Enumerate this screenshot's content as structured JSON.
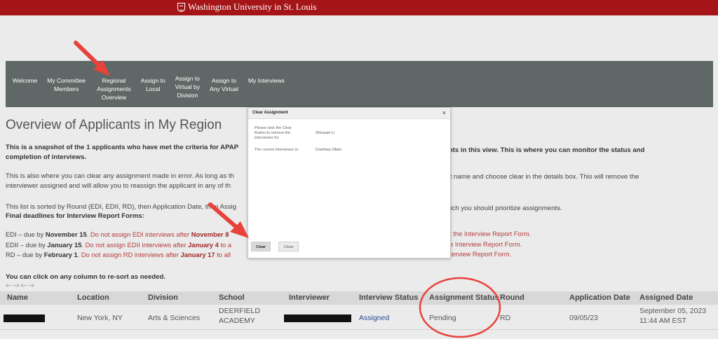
{
  "brand": {
    "name": "Washington University in St. Louis"
  },
  "nav": {
    "items": [
      "Welcome",
      "My Committee\nMembers",
      "Regional\nAssignments\nOverview",
      "Assign to\nLocal",
      "Assign to\nVirtual by\nDivision",
      "Assign to\nAny Virtual",
      "My Interviews"
    ]
  },
  "page": {
    "title": "Overview of Applicants in My Region",
    "p1_left": "This is a snapshot of the 1 applicants who have met the criteria for APAP",
    "p1_right": "ments in this view. This is where you can monitor the status and",
    "p1_line2": "completion of interviews.",
    "p2_left": "This is also where you can clear any assignment made in error.  As long as th",
    "p2_right": "licant name and choose clear in the details box.  This will remove the",
    "p2_line2": "interviewer assigned and will allow you to reassign the applicant in any of th",
    "p3_left": "This list is sorted by Round (EDI, EDII, RD), then Application Date, then Assig",
    "p3_right": "which you should prioritize assignments.",
    "p4": "Final deadlines for Interview Report Forms:",
    "deadlines": [
      {
        "lead": "EDI – due by ",
        "date": "November 15",
        "warn": ".  Do not assign EDI interviews after ",
        "wdate": "November 8",
        "rest": "bmit the Interview Report Form."
      },
      {
        "lead": "EDII – due by ",
        "date": "January 15",
        "warn": ".  Do not assign EDII interviews after ",
        "wdate": "January 4",
        "wtail": " to a",
        "rest": "it the Interview Report Form."
      },
      {
        "lead": "RD – due by ",
        "date": "February 1",
        "warn": ".  Do not assign RD interviews after ",
        "wdate": "January 17",
        "wtail": " to all",
        "rest": "e Interview Report Form."
      }
    ],
    "resort": "You can click on any column to re-sort as needed.",
    "pager": "<-- --> <-- -->"
  },
  "table": {
    "headers": [
      "Name",
      "Location",
      "Division",
      "School",
      "Interviewer",
      "Interview Status",
      "Assignment Status",
      "Round",
      "Application Date",
      "Assigned Date"
    ],
    "row": {
      "location": "New York, NY",
      "division": "Arts & Sciences",
      "school_line1": "DEERFIELD",
      "school_line2": "ACADEMY",
      "interview_status": "Assigned",
      "assignment_status": "Pending",
      "round": "RD",
      "application_date": "09/05/23",
      "assigned_date_line1": "September 05, 2023",
      "assigned_date_line2": "11:44 AM EST"
    }
  },
  "modal": {
    "title": "Clear Assignment",
    "close_glyph": "×",
    "label1_l1": "Please click the Clear",
    "label1_l2": "Button to remove the",
    "label1_l3": "interviewer for",
    "value1": "Zhexuan Li",
    "label2": "The current interviewer is:",
    "value2": "Courtney Oben",
    "clear_label": "Clear",
    "close_label": "Close"
  },
  "colors": {
    "brand_red": "#a51417",
    "nav_bg": "#5f6866",
    "annotation_red": "#e8423a"
  }
}
